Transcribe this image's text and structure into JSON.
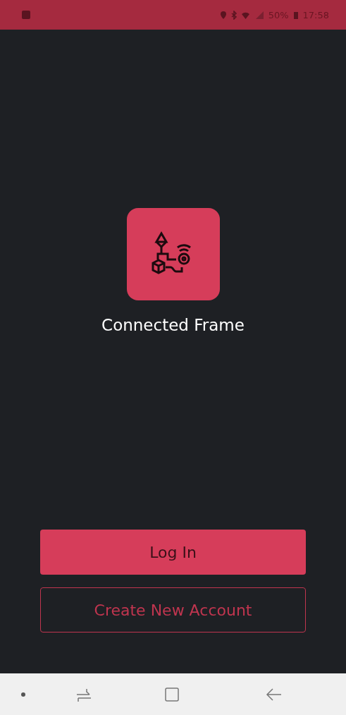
{
  "status_bar": {
    "battery": "50%",
    "time": "17:58"
  },
  "app": {
    "name": "Connected Frame"
  },
  "buttons": [
    {
      "label": "Log In",
      "kind": "primary"
    },
    {
      "label": "Create New Account",
      "kind": "outline"
    }
  ]
}
